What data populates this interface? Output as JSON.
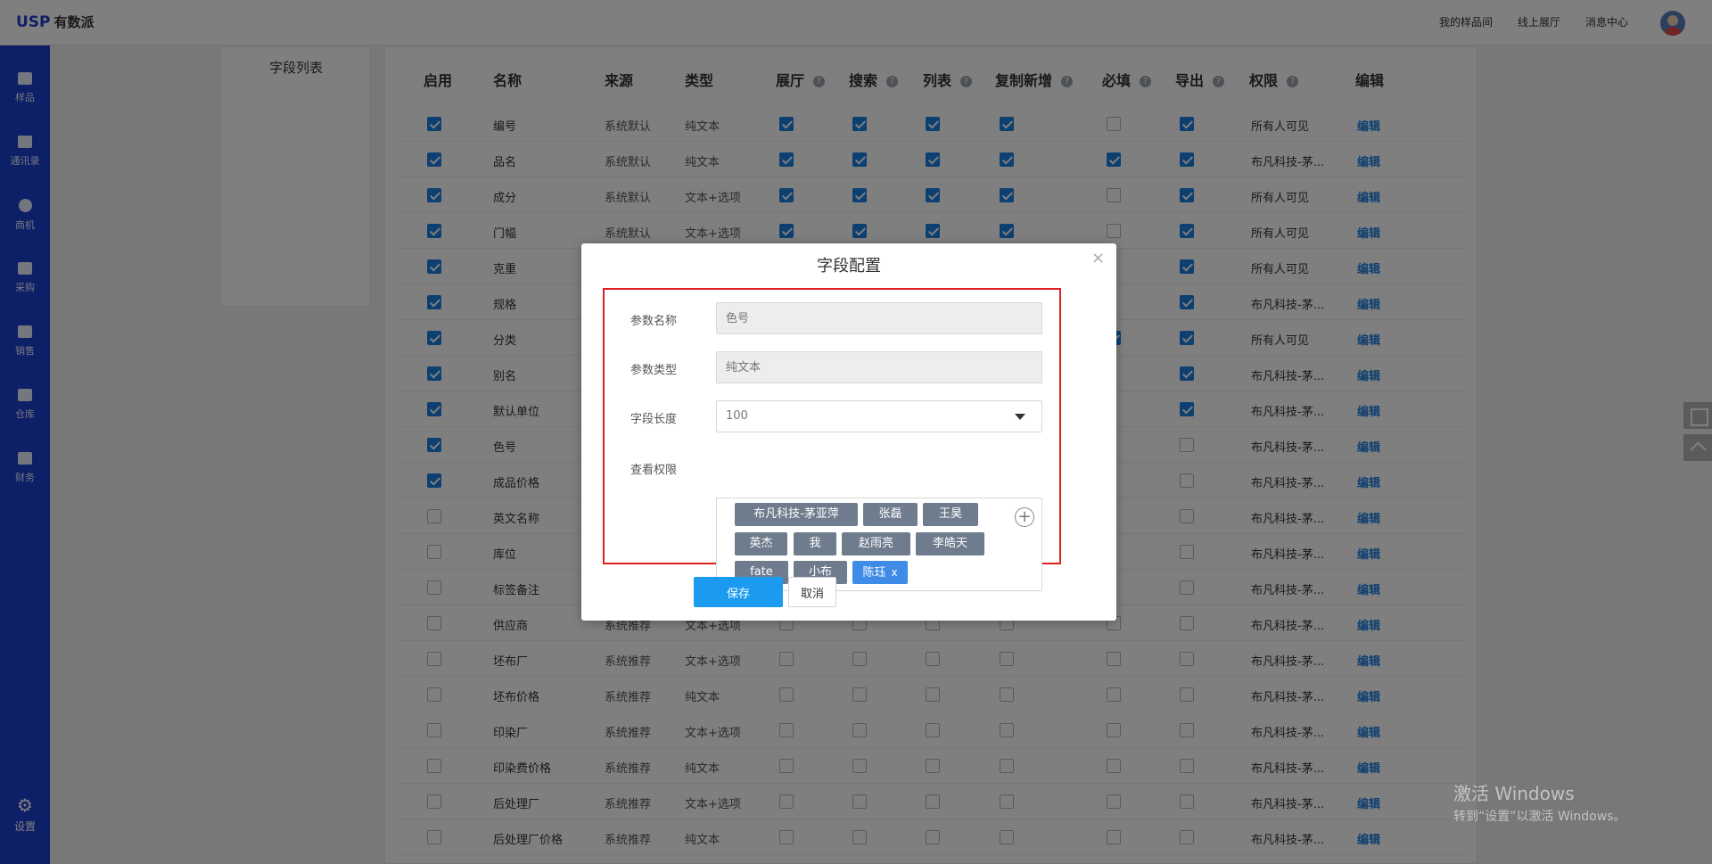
{
  "app": {
    "logo_mark": "USP",
    "logo_text": "有数派",
    "nav": [
      "我的样品间",
      "线上展厅",
      "消息中心"
    ],
    "avatar_icon": "user-avatar",
    "accent_color": "#1b3fcf"
  },
  "sidebar": {
    "items": [
      {
        "label": "样品",
        "icon": "sample-icon"
      },
      {
        "label": "通讯录",
        "icon": "contacts-icon"
      },
      {
        "label": "商机",
        "icon": "opportunity-icon"
      },
      {
        "label": "采购",
        "icon": "purchase-icon"
      },
      {
        "label": "销售",
        "icon": "sales-icon"
      },
      {
        "label": "仓库",
        "icon": "warehouse-icon"
      },
      {
        "label": "财务",
        "icon": "finance-icon"
      }
    ],
    "settings_label": "设置"
  },
  "left_panel": {
    "title": "字段列表"
  },
  "table": {
    "headers": [
      "启用",
      "名称",
      "来源",
      "类型",
      "展厅",
      "搜索",
      "列表",
      "复制新增",
      "必填",
      "导出",
      "权限",
      "编辑"
    ],
    "rows": [
      {
        "enabled": true,
        "name": "编号",
        "source": "系统默认",
        "type": "纯文本",
        "hall": true,
        "search": true,
        "list": true,
        "copy": true,
        "required": false,
        "export": true,
        "permission": "所有人可见",
        "edit": "编辑"
      },
      {
        "enabled": true,
        "name": "品名",
        "source": "系统默认",
        "type": "纯文本",
        "hall": true,
        "search": true,
        "list": true,
        "copy": true,
        "required": true,
        "export": true,
        "permission": "布凡科技-茅...",
        "edit": "编辑"
      },
      {
        "enabled": true,
        "name": "成分",
        "source": "系统默认",
        "type": "文本+选项",
        "hall": true,
        "search": true,
        "list": true,
        "copy": true,
        "required": false,
        "export": true,
        "permission": "所有人可见",
        "edit": "编辑"
      },
      {
        "enabled": true,
        "name": "门幅",
        "source": "系统默认",
        "type": "文本+选项",
        "hall": true,
        "search": true,
        "list": true,
        "copy": true,
        "required": false,
        "export": true,
        "permission": "所有人可见",
        "edit": "编辑"
      },
      {
        "enabled": true,
        "name": "克重",
        "source": "",
        "type": "",
        "hall": null,
        "search": null,
        "list": null,
        "copy": null,
        "required": null,
        "export": true,
        "permission": "所有人可见",
        "edit": "编辑"
      },
      {
        "enabled": true,
        "name": "规格",
        "source": "",
        "type": "",
        "hall": null,
        "search": null,
        "list": null,
        "copy": null,
        "required": null,
        "export": true,
        "permission": "布凡科技-茅...",
        "edit": "编辑"
      },
      {
        "enabled": true,
        "name": "分类",
        "source": "",
        "type": "",
        "hall": null,
        "search": null,
        "list": null,
        "copy": null,
        "required": true,
        "export": true,
        "permission": "所有人可见",
        "edit": "编辑"
      },
      {
        "enabled": true,
        "name": "别名",
        "source": "",
        "type": "",
        "hall": null,
        "search": null,
        "list": null,
        "copy": null,
        "required": null,
        "export": true,
        "permission": "布凡科技-茅...",
        "edit": "编辑"
      },
      {
        "enabled": true,
        "name": "默认单位",
        "source": "",
        "type": "",
        "hall": null,
        "search": null,
        "list": null,
        "copy": null,
        "required": null,
        "export": true,
        "permission": "布凡科技-茅...",
        "edit": "编辑"
      },
      {
        "enabled": true,
        "name": "色号",
        "source": "",
        "type": "",
        "hall": null,
        "search": null,
        "list": null,
        "copy": null,
        "required": null,
        "export": false,
        "permission": "布凡科技-茅...",
        "edit": "编辑"
      },
      {
        "enabled": true,
        "name": "成品价格",
        "source": "",
        "type": "",
        "hall": null,
        "search": null,
        "list": null,
        "copy": null,
        "required": null,
        "export": false,
        "permission": "布凡科技-茅...",
        "edit": "编辑"
      },
      {
        "enabled": false,
        "name": "英文名称",
        "source": "",
        "type": "",
        "hall": null,
        "search": null,
        "list": null,
        "copy": null,
        "required": null,
        "export": false,
        "permission": "布凡科技-茅...",
        "edit": "编辑"
      },
      {
        "enabled": false,
        "name": "库位",
        "source": "",
        "type": "",
        "hall": null,
        "search": null,
        "list": null,
        "copy": null,
        "required": null,
        "export": false,
        "permission": "布凡科技-茅...",
        "edit": "编辑"
      },
      {
        "enabled": false,
        "name": "标签备注",
        "source": "",
        "type": "",
        "hall": null,
        "search": null,
        "list": null,
        "copy": null,
        "required": null,
        "export": false,
        "permission": "布凡科技-茅...",
        "edit": "编辑"
      },
      {
        "enabled": false,
        "name": "供应商",
        "source": "系统推荐",
        "type": "文本+选项",
        "hall": false,
        "search": false,
        "list": false,
        "copy": false,
        "required": false,
        "export": false,
        "permission": "布凡科技-茅...",
        "edit": "编辑"
      },
      {
        "enabled": false,
        "name": "坯布厂",
        "source": "系统推荐",
        "type": "文本+选项",
        "hall": false,
        "search": false,
        "list": false,
        "copy": false,
        "required": false,
        "export": false,
        "permission": "布凡科技-茅...",
        "edit": "编辑"
      },
      {
        "enabled": false,
        "name": "坯布价格",
        "source": "系统推荐",
        "type": "纯文本",
        "hall": false,
        "search": false,
        "list": false,
        "copy": false,
        "required": false,
        "export": false,
        "permission": "布凡科技-茅...",
        "edit": "编辑"
      },
      {
        "enabled": false,
        "name": "印染厂",
        "source": "系统推荐",
        "type": "文本+选项",
        "hall": false,
        "search": false,
        "list": false,
        "copy": false,
        "required": false,
        "export": false,
        "permission": "布凡科技-茅...",
        "edit": "编辑"
      },
      {
        "enabled": false,
        "name": "印染费价格",
        "source": "系统推荐",
        "type": "纯文本",
        "hall": false,
        "search": false,
        "list": false,
        "copy": false,
        "required": false,
        "export": false,
        "permission": "布凡科技-茅...",
        "edit": "编辑"
      },
      {
        "enabled": false,
        "name": "后处理厂",
        "source": "系统推荐",
        "type": "文本+选项",
        "hall": false,
        "search": false,
        "list": false,
        "copy": false,
        "required": false,
        "export": false,
        "permission": "布凡科技-茅...",
        "edit": "编辑"
      },
      {
        "enabled": false,
        "name": "后处理厂价格",
        "source": "系统推荐",
        "type": "纯文本",
        "hall": false,
        "search": false,
        "list": false,
        "copy": false,
        "required": false,
        "export": false,
        "permission": "布凡科技-茅...",
        "edit": "编辑"
      }
    ]
  },
  "modal": {
    "title": "字段配置",
    "close_icon": "close-icon",
    "param_name_label": "参数名称",
    "param_name_placeholder": "色号",
    "param_type_label": "参数类型",
    "param_type_placeholder": "纯文本",
    "length_label": "字段长度",
    "length_value": "100",
    "permission_label": "查看权限",
    "tags": [
      {
        "label": "布凡科技-茅亚萍",
        "selected": false
      },
      {
        "label": "张磊",
        "selected": false
      },
      {
        "label": "王昊",
        "selected": false
      },
      {
        "label": "英杰",
        "selected": false
      },
      {
        "label": "我",
        "selected": false
      },
      {
        "label": "赵雨亮",
        "selected": false
      },
      {
        "label": "李皓天",
        "selected": false
      },
      {
        "label": "fate",
        "selected": false
      },
      {
        "label": "小布",
        "selected": false
      },
      {
        "label": "陈珏",
        "selected": true
      }
    ],
    "tag_remove": "x",
    "add_icon": "plus-circle-icon",
    "save_label": "保存",
    "cancel_label": "取消",
    "highlight_color": "#e02020",
    "primary_color": "#1a9bf0"
  },
  "watermark": {
    "line1": "激活 Windows",
    "line2": "转到“设置”以激活 Windows。"
  }
}
